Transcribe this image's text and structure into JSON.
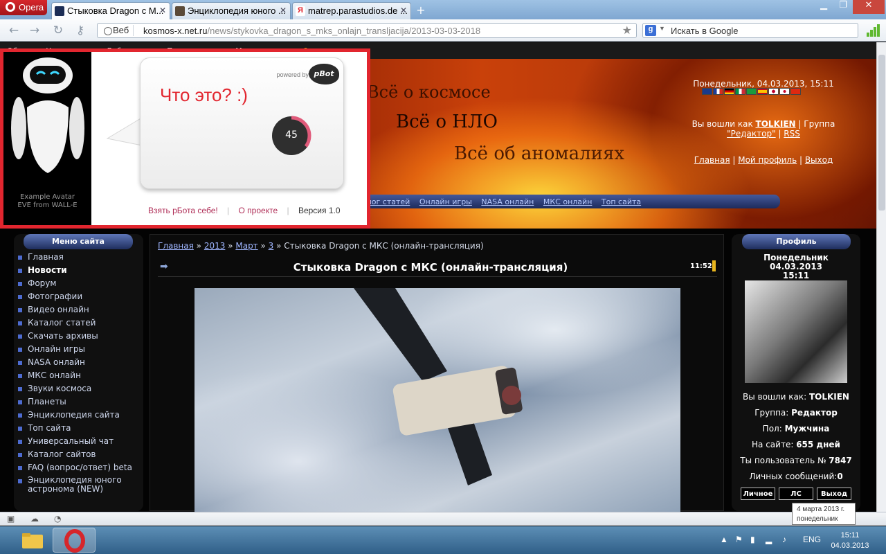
{
  "browser": {
    "opera_label": "Opera",
    "tabs": [
      {
        "title": "Стыковка Dragon с М...",
        "active": true
      },
      {
        "title": "Энциклопедия юного ...",
        "active": false
      },
      {
        "title": "matrep.parastudios.de ...",
        "active": false
      }
    ],
    "address_badge": "Веб",
    "url_host": "kosmos-x.net.ru",
    "url_path": "/news/stykovka_dragon_s_mks_onlajn_transljacija/2013-03-03-2018",
    "search_placeholder": "Искать в Google"
  },
  "admin_bar": [
    "Общее",
    "Управление",
    "Добавление",
    "Пользователи",
    "Мультимедиа"
  ],
  "header": {
    "slogans": [
      "Всё о космосе",
      "Всё о НЛО",
      "Всё об аномалиях"
    ],
    "datetime": "Понедельник, 04.03.2013, 15:11",
    "logged_prefix": "Вы вошли как",
    "user": "TOLKIEN",
    "group_prefix": "| Группа",
    "group": "\"Редактор\"",
    "rss": "RSS",
    "links": [
      "Главная",
      "Мой профиль",
      "Выход"
    ]
  },
  "top_menu": [
    "алог статей",
    "Онлайн игры",
    "NASA онлайн",
    "МКС онлайн",
    "Топ сайта"
  ],
  "left_menu": {
    "title": "Меню сайта",
    "items": [
      "Главная",
      "Новости",
      "Форум",
      "Фотографии",
      "Видео онлайн",
      "Каталог статей",
      "Скачать архивы",
      "Онлайн игры",
      "NASA онлайн",
      "МКС онлайн",
      "Звуки космоса",
      "Планеты",
      "Энциклопедия сайта",
      "Топ сайта",
      "Универсальный чат",
      "Каталог сайтов",
      "FAQ (вопрос/ответ) beta",
      "Энциклопедия юного астронома (NEW)"
    ],
    "current": 1
  },
  "article": {
    "breadcrumbs": [
      "Главная",
      "2013",
      "Март",
      "3"
    ],
    "breadcrumb_current": "Стыковка Dragon с МКС (онлайн-трансляция)",
    "title": "Стыковка Dragon с МКС (онлайн-трансляция)",
    "time": "11:52"
  },
  "profile": {
    "title": "Профиль",
    "day": "Понедельник",
    "date": "04.03.2013",
    "time": "15:11",
    "rows": [
      {
        "label": "Вы вошли как:",
        "value": "TOLKIEN"
      },
      {
        "label": "Группа:",
        "value": "Редактор"
      },
      {
        "label": "Пол:",
        "value": "Мужчина"
      },
      {
        "label": "На сайте:",
        "value": "655 дней"
      },
      {
        "label": "Ты пользователь №",
        "value": "7847"
      },
      {
        "label": "Личных сообщений:",
        "value": "0"
      }
    ],
    "buttons": [
      "Личное",
      "ЛС",
      "Выход"
    ]
  },
  "pbot": {
    "avatar_caption_1": "Example Avatar",
    "avatar_caption_2": "EVE from WALL-E",
    "powered_by": "powered by",
    "logo_text": "pBot",
    "question": "Что это? :)",
    "counter": "45",
    "counter_fraction": 0.35,
    "links": [
      "Взять рБота себе!",
      "О проекте"
    ],
    "version": "Версия 1.0"
  },
  "tooltip": {
    "line1": "4 марта 2013 г.",
    "line2": "понедельник"
  },
  "taskbar": {
    "lang": "ENG",
    "time": "15:11",
    "date": "04.03.2013"
  },
  "colors": {
    "accent_red": "#e2262f",
    "link_blue": "#9fb6ff",
    "pbot_link": "#b02f58"
  }
}
